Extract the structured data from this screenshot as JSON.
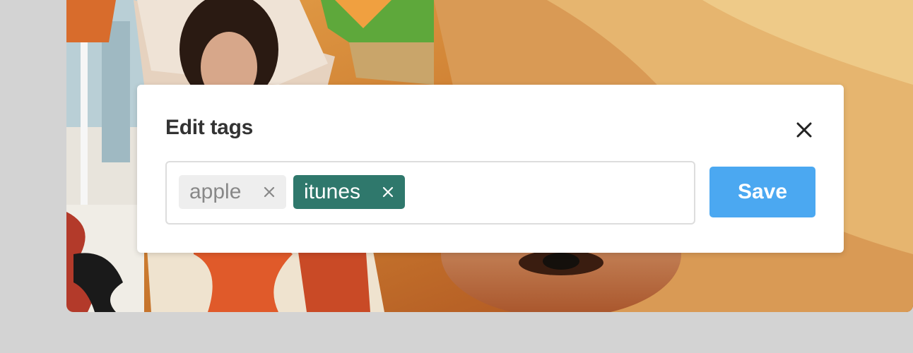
{
  "modal": {
    "title": "Edit tags",
    "close_icon": "close-icon",
    "tags": [
      {
        "label": "apple",
        "remove_icon": "close-icon",
        "state": "default"
      },
      {
        "label": "itunes",
        "remove_icon": "close-icon",
        "state": "selected"
      }
    ],
    "save_label": "Save"
  },
  "colors": {
    "page_background": "#d3d3d3",
    "modal_background": "#ffffff",
    "title_text": "#333333",
    "tag_default_bg": "#eeeeee",
    "tag_default_text": "#888888",
    "tag_selected_bg": "#2f786c",
    "tag_selected_text": "#ffffff",
    "save_button_bg": "#4ba8f1"
  }
}
